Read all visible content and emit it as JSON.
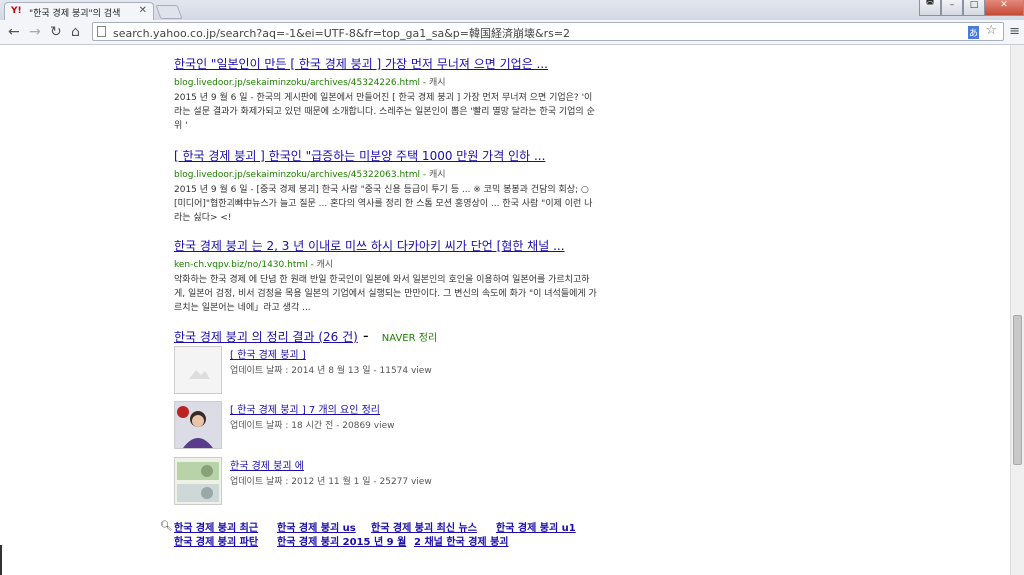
{
  "browser": {
    "tab_favicon": "Y!",
    "tab_title": "\"한국 경제 붕괴\"의 검색",
    "url": "search.yahoo.co.jp/search?aq=-1&ei=UTF-8&fr=top_ga1_sa&p=韓国経済崩壊&rs=2"
  },
  "results": [
    {
      "title": "한국인 \"일본인이 만든 [ 한국 경제 붕괴 ] 가장 먼저 무너져 으면 기업은 ...",
      "url": "blog.livedoor.jp/sekaiminzoku/archives/45324226.html",
      "cache": "캐시",
      "desc": "2015 년 9 월 6 일 - 한국의 게시판에 일본에서 만들어진 [ 한국 경제 붕괴 ] 가장 먼저 무너져 으면 기업은? '이라는 설문 결과가 화제가되고 있던 때문에 소개합니다. 스레주는 일본인이 뽑은 '빨리 멸망 달라는 한국 기업의 순위 '"
    },
    {
      "title": "[ 한국 경제 붕괴 ] 한국인 \"급증하는 미분양 주택 1000 만원 가격 인하 ...",
      "url": "blog.livedoor.jp/sekaiminzoku/archives/45322063.html",
      "cache": "캐시",
      "desc": "2015 년 9 월 6 일 - [중국 경제 붕괴] 한국 사람 \"중국 신용 등급이 투기 등 ... ※ 코믹 봉봉과 건담의 회상; ○ [미디어]\"협한괴뺘中뉴스가 늘고 질문 ... 혼다의 역사를 정리 한 스톰 모션 홍영상이 ... 한국 사람 \"이제 이런 나라는 싫다> <!"
    },
    {
      "title": "한국 경제 붕괴 는 2, 3 년 이내로 미쓰 하시 다카아키 씨가 단언 [혐한 채널 ...",
      "url": "ken-ch.vqpv.biz/no/1430.html",
      "cache": "캐시",
      "desc": "악화하는 한국 경제 에 단념 한 원래 반일 한국인이 일본에 와서 일본인의 호인을 이용하여 일본어를 가르치고하게, 일본어 검정, 비서 검정을 목용 일본의 기업에서 실행되는 만만이다. 그 변신의 속도에 화가 \"이 녀석들에게 가르치는 일본어는 네에」라고 생각 ..."
    }
  ],
  "naver": {
    "title": "한국 경제 붕괴 의 정리 결과 (26 건)",
    "source": "NAVER 정리",
    "items": [
      {
        "title": "[ 한국 경제 붕괴 ]",
        "meta": "업데이트 날짜 : 2014 년 8 월 13 일   -   11574 view",
        "thumb": "placeholder-image-icon"
      },
      {
        "title": "[ 한국 경제 붕괴 ]  7 개의 요인 정리",
        "meta": "업데이트 날짜 : 18 시간 전   -   20869 view",
        "thumb": "person-photo"
      },
      {
        "title": "한국 경제 붕괴 에",
        "meta": "업데이트 날짜 : 2012 년 11 월 1 일   -   25277 view",
        "thumb": "banknote-photo"
      }
    ]
  },
  "related": [
    "한국 경제 붕괴 최근",
    "한국 경제 붕괴 us",
    "한국 경제 붕괴 최신 뉴스",
    "한국 경제 붕괴 u1",
    "한국 경제 붕괴 파탄",
    "한국 경제 붕괴 2015 년 9 월",
    "2 채널 한국 경제 붕괴"
  ]
}
